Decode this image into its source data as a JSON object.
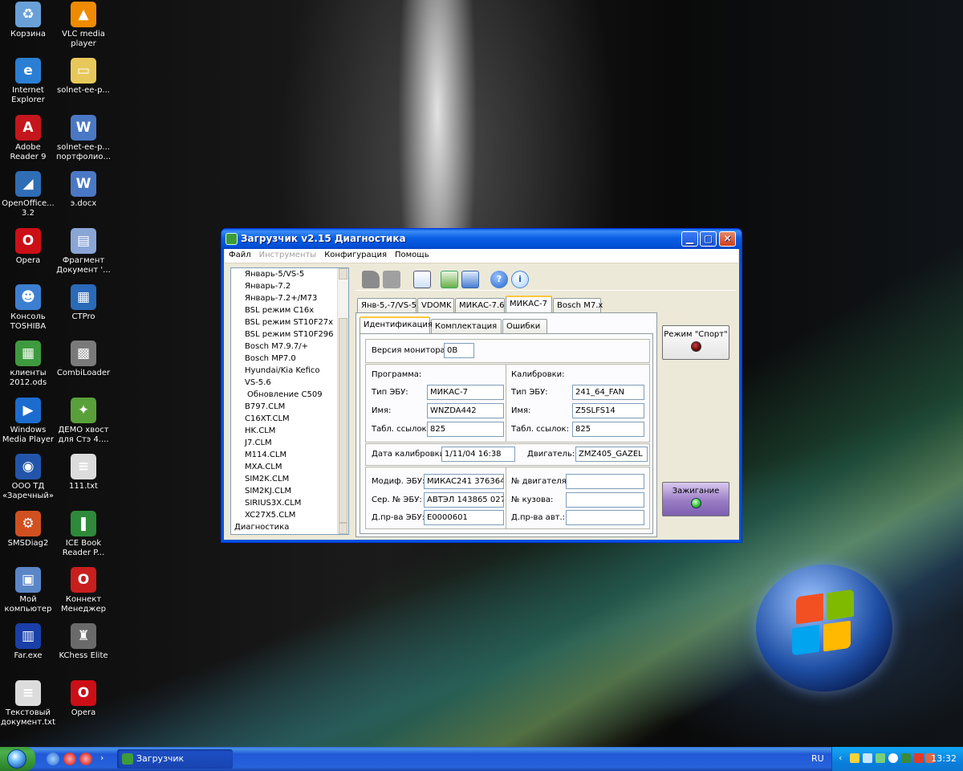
{
  "desktop_icons": [
    {
      "label": "Корзина",
      "icon": "recycle-bin-icon",
      "color": "#6aa0d8",
      "glyph": "♻"
    },
    {
      "label": "VLC media player",
      "icon": "vlc-cone-icon",
      "color": "#f08a00",
      "glyph": "▲"
    },
    {
      "label": "Internet Explorer",
      "icon": "internet-explorer-icon",
      "color": "#2a7fd4",
      "glyph": "e"
    },
    {
      "label": "solnet-ee-p...",
      "icon": "folder-icon",
      "color": "#e8c85a",
      "glyph": "▭"
    },
    {
      "label": "Adobe Reader 9",
      "icon": "adobe-reader-icon",
      "color": "#c4161c",
      "glyph": "A"
    },
    {
      "label": "solnet-ee-p... портфолио...",
      "icon": "word-document-icon",
      "color": "#4a78c4",
      "glyph": "W"
    },
    {
      "label": "OpenOffice... 3.2",
      "icon": "openoffice-icon",
      "color": "#2f6db5",
      "glyph": "◢"
    },
    {
      "label": "э.docx",
      "icon": "word-document-icon",
      "color": "#4a78c4",
      "glyph": "W"
    },
    {
      "label": "Opera",
      "icon": "opera-icon",
      "color": "#cc0f16",
      "glyph": "O"
    },
    {
      "label": "Фрагмент Документ '...",
      "icon": "document-fragment-icon",
      "color": "#8aa6d6",
      "glyph": "▤"
    },
    {
      "label": "Консоль TOSHIBA",
      "icon": "toshiba-console-icon",
      "color": "#3c7fd0",
      "glyph": "☻"
    },
    {
      "label": "CTPro",
      "icon": "ctpro-icon",
      "color": "#2a6ab8",
      "glyph": "▦"
    },
    {
      "label": "клиенты 2012.ods",
      "icon": "spreadsheet-icon",
      "color": "#3e9a3e",
      "glyph": "▦"
    },
    {
      "label": "CombiLoader",
      "icon": "combiloader-chip-icon",
      "color": "#7a7a7a",
      "glyph": "▩"
    },
    {
      "label": "Windows Media Player",
      "icon": "media-player-icon",
      "color": "#1c6ccf",
      "glyph": "▶"
    },
    {
      "label": "ДЕМО хвост для Стэ 4....",
      "icon": "demo-program-icon",
      "color": "#5aa03a",
      "glyph": "✦"
    },
    {
      "label": "ООО ТД «Заречный»",
      "icon": "company-logo-icon",
      "color": "#2255aa",
      "glyph": "◉"
    },
    {
      "label": "111.txt",
      "icon": "text-file-icon",
      "color": "#dcdcdc",
      "glyph": "≡"
    },
    {
      "label": "SMSDiag2",
      "icon": "smsdiag-icon",
      "color": "#d05020",
      "glyph": "⚙"
    },
    {
      "label": "ICE Book Reader P...",
      "icon": "ice-book-reader-icon",
      "color": "#2e8a3a",
      "glyph": "❚"
    },
    {
      "label": "Мой компьютер",
      "icon": "my-computer-icon",
      "color": "#5a86c8",
      "glyph": "▣"
    },
    {
      "label": "Коннект Менеджер",
      "icon": "connect-manager-icon",
      "color": "#c81e1e",
      "glyph": "O"
    },
    {
      "label": "Far.exe",
      "icon": "far-manager-icon",
      "color": "#1a3fa8",
      "glyph": "▥"
    },
    {
      "label": "KChess Elite",
      "icon": "chess-icon",
      "color": "#6a6a6a",
      "glyph": "♜"
    },
    {
      "label": "Текстовый документ.txt",
      "icon": "text-file-icon",
      "color": "#dcdcdc",
      "glyph": "≡"
    },
    {
      "label": "Opera",
      "icon": "opera-icon",
      "color": "#cc0f16",
      "glyph": "O"
    }
  ],
  "window": {
    "title": "Загрузчик v2.15 Диагностика",
    "menu": [
      {
        "label": "Файл",
        "enabled": true
      },
      {
        "label": "Инструменты",
        "enabled": false
      },
      {
        "label": "Конфигурация",
        "enabled": true
      },
      {
        "label": "Помощь",
        "enabled": true
      }
    ],
    "tree_items": [
      "Январь-5/VS-5",
      "Январь-7.2",
      "Январь-7.2+/M73",
      "BSL режим C16x",
      "BSL режим ST10F27x",
      "BSL режим ST10F296",
      "Bosch M7.9.7/+",
      "Bosch MP7.0",
      "Hyundai/Kia Kefico",
      "VS-5.6",
      "Обновление C509",
      "B797.CLM",
      "C16XT.CLM",
      "HK.CLM",
      "J7.CLM",
      "M114.CLM",
      "MXA.CLM",
      "SIM2K.CLM",
      "SIM2KJ.CLM",
      "SIRIUS3X.CLM",
      "XC27X5.CLM",
      "Диагностика"
    ],
    "ecu_tabs": [
      "Янв-5,-7/VS-5",
      "VDOMK",
      "МИКАС-7.6",
      "МИКАС-7",
      "Bosch M7.x"
    ],
    "ecu_tab_active": 3,
    "sub_tabs": [
      "Идентификация",
      "Комплектация",
      "Ошибки"
    ],
    "sub_tab_active": 0,
    "monitor_version": {
      "label": "Версия монитора:",
      "value": "0B"
    },
    "program": {
      "title": "Программа:",
      "ecu_type_label": "Тип ЭБУ:",
      "ecu_type": "МИКАС-7",
      "name_label": "Имя:",
      "name": "WNZDA442",
      "table_label": "Табл. ссылок:",
      "table": "825"
    },
    "calibrations": {
      "title": "Калибровки:",
      "ecu_type_label": "Тип ЭБУ:",
      "ecu_type": "241_64_FAN",
      "name_label": "Имя:",
      "name": "Z5SLFS14",
      "table_label": "Табл. ссылок:",
      "table": "825"
    },
    "calibration_date": {
      "label": "Дата калибровки:",
      "value": "1/11/04 16:38"
    },
    "engine": {
      "label": "Двигатель:",
      "value": "ZMZ405_GAZEL"
    },
    "ecu_info": {
      "mod_label": "Модиф. ЭБУ:",
      "mod": "МИКАС241 376364",
      "serial_label": "Сер. № ЭБУ:",
      "serial": "АВТЭЛ 143865 027",
      "date_label": "Д.пр-ва ЭБУ:",
      "date": "E0000601"
    },
    "vehicle_info": {
      "engine_no_label": "№ двигателя:",
      "engine_no": "",
      "body_no_label": "№ кузова:",
      "body_no": "",
      "car_date_label": "Д.пр-ва авт.:",
      "car_date": ""
    },
    "sport_button": "Режим \"Спорт\"",
    "ignition_button": "Зажигание"
  },
  "taskbar": {
    "task_label": "Загрузчик",
    "language": "RU",
    "clock": "13:32"
  },
  "colors": {
    "title_blue": "#0054e3",
    "ignition_purple": "#9a7cc4",
    "sport_led": "#5a0000",
    "ignition_led": "#3fcf3f"
  }
}
